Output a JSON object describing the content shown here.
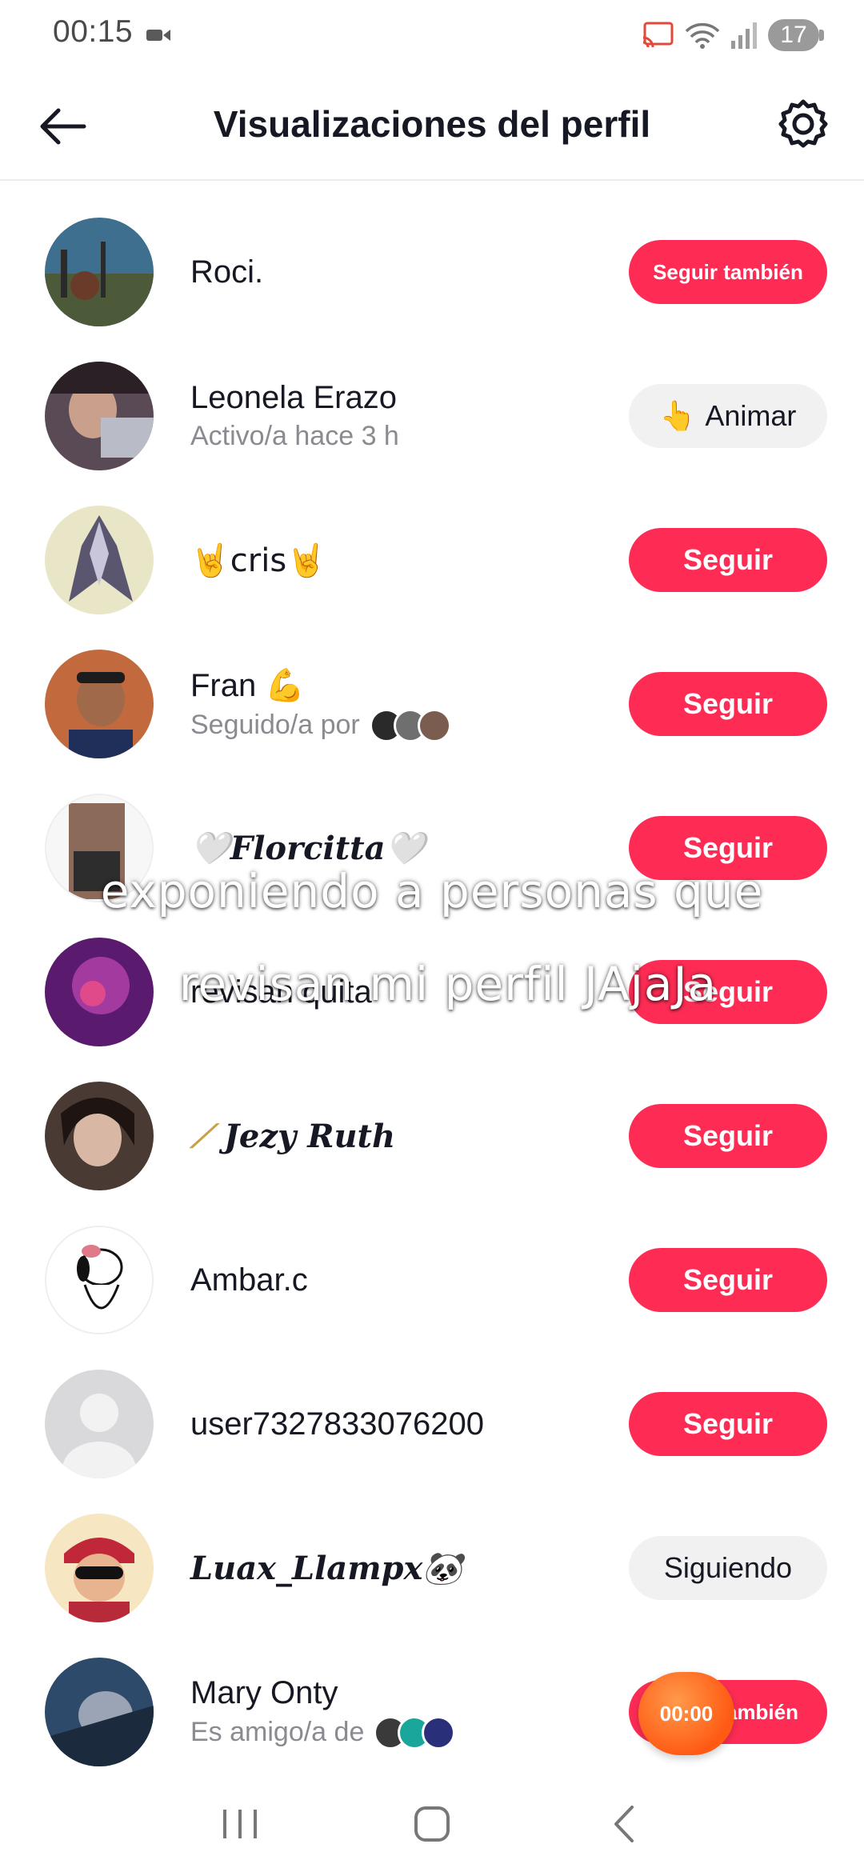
{
  "status_bar": {
    "time": "00:15",
    "battery": "17",
    "icons": [
      "video-camera-icon",
      "cast-icon",
      "wifi-icon",
      "signal-icon",
      "battery-icon"
    ]
  },
  "header": {
    "title": "Visualizaciones del perfil",
    "back_icon": "arrow-left-icon",
    "settings_icon": "gear-icon"
  },
  "rows": [
    {
      "name": "Roci.",
      "sub": "",
      "button": "Seguir también"
    },
    {
      "name": "Leonela Erazo",
      "sub": "Activo/a hace 3 h",
      "button": "Animar",
      "button_emoji": "👆"
    },
    {
      "name": "🤘cris🤘",
      "sub": "",
      "button": "Seguir"
    },
    {
      "name": "Fran 💪",
      "sub": "Seguido/a por",
      "button": "Seguir"
    },
    {
      "name": "🤍Florcitta🤍",
      "sub": "",
      "button": "Seguir"
    },
    {
      "name": "revisan quita",
      "sub": "",
      "button": "Seguir"
    },
    {
      "name": "Jezy Ruth",
      "sub": "",
      "button": "Seguir"
    },
    {
      "name": "Ambar.c",
      "sub": "",
      "button": "Seguir"
    },
    {
      "name": "user7327833076200",
      "sub": "",
      "button": "Seguir"
    },
    {
      "name": "Luax_Llampx🐼",
      "sub": "",
      "button": "Siguiendo"
    },
    {
      "name": "Mary Onty",
      "sub": "Es amigo/a de",
      "button": "ambién"
    }
  ],
  "overlay": {
    "line1": "exponiendo a personas que",
    "line2": "revisan mi perfil JAjaJa"
  },
  "record_timer": "00:00",
  "colors": {
    "primary": "#fe2c55",
    "secondary": "#f1f1f2",
    "text": "#161823",
    "subtext": "#8a8b91"
  }
}
